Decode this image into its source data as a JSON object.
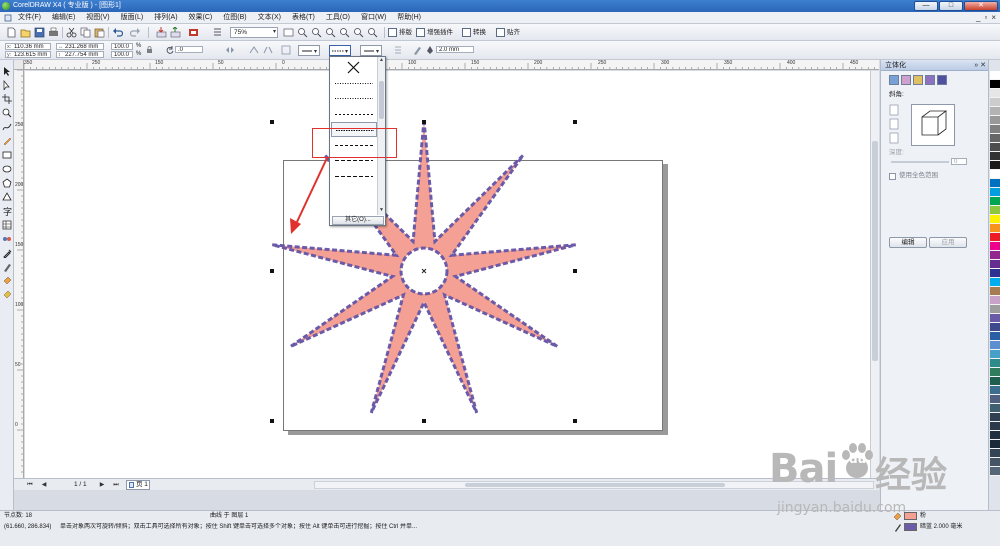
{
  "window": {
    "title": "CorelDRAW X4 ( 专业版 ) - [图形1]",
    "buttons": {
      "minimize": "—",
      "maximize": "□",
      "close": "✕"
    }
  },
  "menubar": {
    "items": [
      "文件(F)",
      "编辑(E)",
      "视图(V)",
      "版面(L)",
      "排列(A)",
      "效果(C)",
      "位图(B)",
      "文本(X)",
      "表格(T)",
      "工具(O)",
      "窗口(W)",
      "帮助(H)"
    ],
    "window_controls": [
      "_",
      "▫",
      "×"
    ]
  },
  "toolbar": {
    "zoom": "75%",
    "align_label": "排版",
    "plugin_label": "增强插件",
    "convert_label": "转换",
    "paste_label": "贴齐"
  },
  "property_bar": {
    "x": "110.36 mm",
    "y": "123.615 mm",
    "width": "231.268 mm",
    "height": "227.754 mm",
    "scale_x": "100.0",
    "scale_y": "100.0",
    "percent_x": "%",
    "percent_y": "%",
    "rotation": ".0",
    "outline_width": "2.0 mm"
  },
  "rulers": {
    "horizontal": [
      "350",
      "300",
      "250",
      "200",
      "150",
      "100",
      "50",
      "0",
      "50",
      "100",
      "150",
      "200",
      "250",
      "300",
      "350",
      "400",
      "450",
      "500",
      "550"
    ],
    "vertical": [
      "350",
      "300",
      "250",
      "200",
      "150",
      "100",
      "50",
      "0",
      "50"
    ]
  },
  "line_style_dropdown": {
    "other_button": "其它(O)...",
    "options": [
      "none",
      "dotted-fine",
      "dotted-fine",
      "dash-short",
      "dashed-selected",
      "dash-medium",
      "dash-long",
      "dash-long"
    ]
  },
  "drawing": {
    "shape": "9-point star",
    "fill_color": "#F4A094",
    "outline_color": "#6A5AA8",
    "annotation_color": "#E0312C"
  },
  "pagebar": {
    "page_count": "1 / 1",
    "page_tab": "页 1"
  },
  "docker": {
    "title": "立体化",
    "controls": "» ✕",
    "section_label": "斜角:",
    "depth_label": "深度:",
    "depth_value": "0",
    "checkbox_label": "使用全色范围",
    "edit_button": "编辑",
    "apply_button": "应用"
  },
  "palette": {
    "colors": [
      "#FFFFFF",
      "#000000",
      "#E6E6E6",
      "#CCCCCC",
      "#B3B3B3",
      "#999999",
      "#808080",
      "#666666",
      "#4D4D4D",
      "#333333",
      "#1A1A1A",
      "#FFFFFF",
      "#0070C0",
      "#00A0E0",
      "#00A651",
      "#8DC63F",
      "#FFF200",
      "#F7941D",
      "#ED1C24",
      "#EC008C",
      "#92278F",
      "#662D91",
      "#2E3192",
      "#00AEEF",
      "#A67C52",
      "#C8A2C8",
      "#9E9E9E",
      "#6A5AA8",
      "#3F4A8C",
      "#2B5FA5",
      "#5B8FD0",
      "#46A0C8",
      "#2E8B8B",
      "#2F7D5D",
      "#1F5F4F",
      "#3C6E8F",
      "#506080",
      "#406070",
      "#304050",
      "#2A3A4A",
      "#203040",
      "#1A2A38",
      "#334455",
      "#445566",
      "#556677"
    ]
  },
  "statusbar": {
    "node_count": "节点数: 18",
    "object_info": "曲线 于 图层 1",
    "coordinates": "(61.660, 286.834)",
    "hint": "单击对象两次可旋转/倾斜；双击工具可选择所有对象；按住 Shift 键单击可选择多个对象；按住 Alt 键单击可进行挖掘；按住 Ctrl 并单...",
    "fill_label": "粉",
    "outline_label": "暗蓝  2.000 毫米"
  },
  "watermark": {
    "brand": "Bai",
    "paw": "du",
    "suffix": "经验",
    "url": "jingyan.baidu.com"
  }
}
